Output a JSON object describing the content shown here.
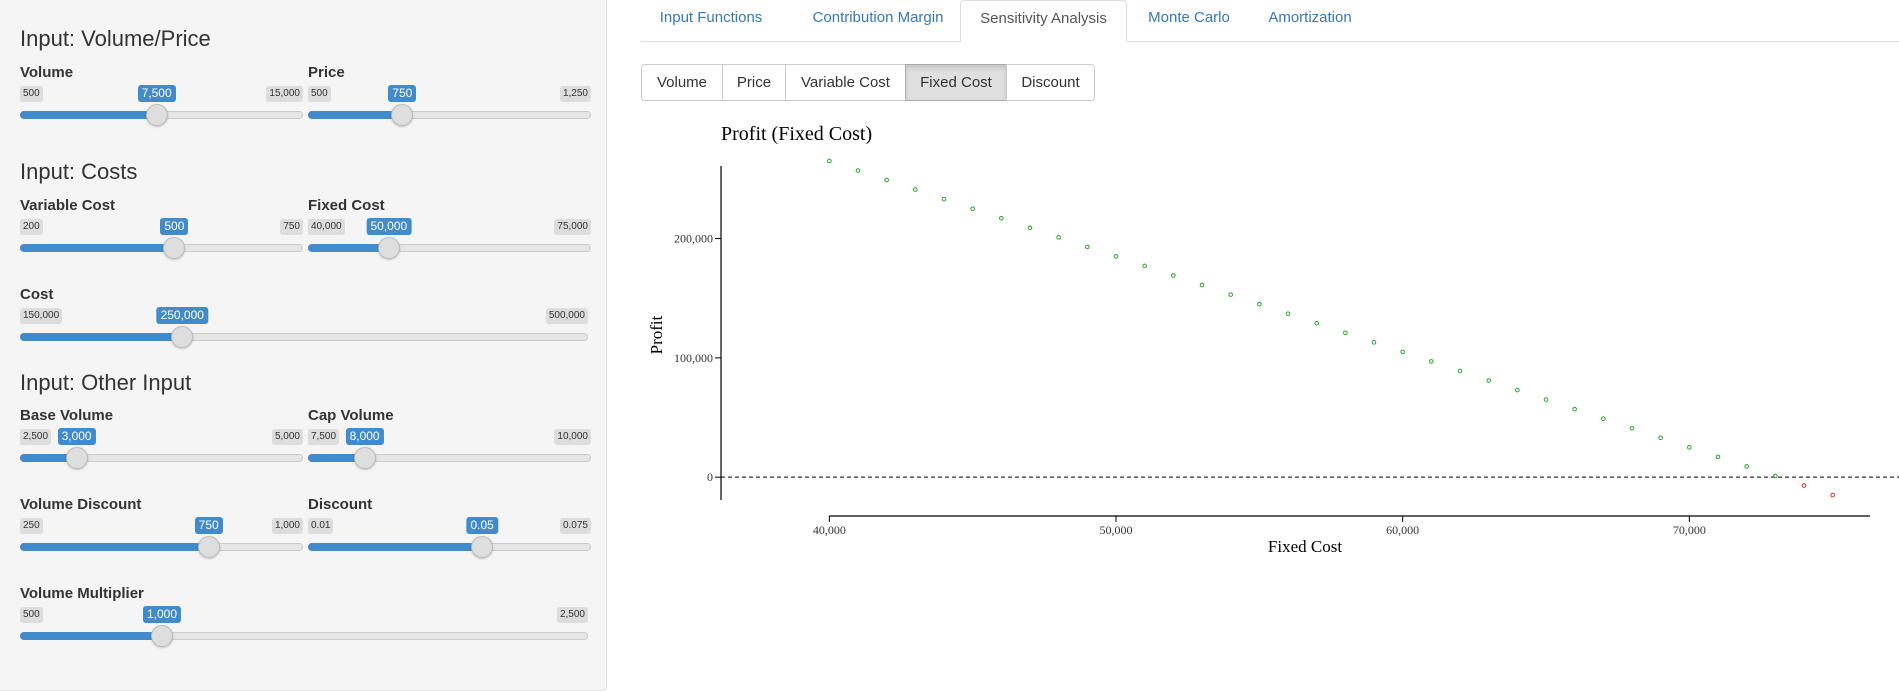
{
  "sidebar": {
    "sections": [
      {
        "title": "Input: Volume/Price"
      },
      {
        "title": "Input: Costs"
      },
      {
        "title": "Input: Other Input"
      }
    ],
    "sliders": [
      {
        "label": "Volume",
        "min": "500",
        "max": "15,000",
        "value": "7,500",
        "fraction": 0.4828
      },
      {
        "label": "Price",
        "min": "500",
        "max": "1,250",
        "value": "750",
        "fraction": 0.3333
      },
      {
        "label": "Variable Cost",
        "min": "200",
        "max": "750",
        "value": "500",
        "fraction": 0.5455
      },
      {
        "label": "Fixed Cost",
        "min": "40,000",
        "max": "75,000",
        "value": "50,000",
        "fraction": 0.2857
      },
      {
        "label": "Cost",
        "min": "150,000",
        "max": "500,000",
        "value": "250,000",
        "fraction": 0.2857
      },
      {
        "label": "Base Volume",
        "min": "2,500",
        "max": "5,000",
        "value": "3,000",
        "fraction": 0.2
      },
      {
        "label": "Cap Volume",
        "min": "7,500",
        "max": "10,000",
        "value": "8,000",
        "fraction": 0.2
      },
      {
        "label": "Volume Discount",
        "min": "250",
        "max": "1,000",
        "value": "750",
        "fraction": 0.6667
      },
      {
        "label": "Discount",
        "min": "0.01",
        "max": "0.075",
        "value": "0.05",
        "fraction": 0.6154
      },
      {
        "label": "Volume Multiplier",
        "min": "500",
        "max": "2,500",
        "value": "1,000",
        "fraction": 0.25
      }
    ]
  },
  "tabs": [
    {
      "label": "Input Functions",
      "active": false
    },
    {
      "label": "Contribution Margin",
      "active": false
    },
    {
      "label": "Sensitivity Analysis",
      "active": true
    },
    {
      "label": "Monte Carlo",
      "active": false
    },
    {
      "label": "Amortization",
      "active": false
    }
  ],
  "buttons": [
    {
      "label": "Volume",
      "active": false
    },
    {
      "label": "Price",
      "active": false
    },
    {
      "label": "Variable Cost",
      "active": false
    },
    {
      "label": "Fixed Cost",
      "active": true
    },
    {
      "label": "Discount",
      "active": false
    }
  ],
  "colors": {
    "accent": "#428bca",
    "positive": "#2ca02c",
    "negative": "#d62728"
  },
  "chart_data": {
    "type": "scatter",
    "title": "Profit (Fixed Cost)",
    "xlabel": "Fixed Cost",
    "ylabel": "Profit",
    "xlim": [
      38000,
      77000
    ],
    "ylim": [
      -25000,
      270000
    ],
    "xticks": [
      {
        "value": 40000,
        "label": "40,000"
      },
      {
        "value": 50000,
        "label": "50,000"
      },
      {
        "value": 60000,
        "label": "60,000"
      },
      {
        "value": 70000,
        "label": "70,000"
      }
    ],
    "yticks": [
      {
        "value": 0,
        "label": "0"
      },
      {
        "value": 100000,
        "label": "100,000"
      },
      {
        "value": 200000,
        "label": "200,000"
      }
    ],
    "reference_line_y": 0,
    "x": [
      40000,
      41000,
      42000,
      43000,
      44000,
      45000,
      46000,
      47000,
      48000,
      49000,
      50000,
      51000,
      52000,
      53000,
      54000,
      55000,
      56000,
      57000,
      58000,
      59000,
      60000,
      61000,
      62000,
      63000,
      64000,
      65000,
      66000,
      67000,
      68000,
      69000,
      70000,
      71000,
      72000,
      73000,
      74000,
      75000
    ],
    "y": [
      265000,
      257000,
      249000,
      241000,
      233000,
      225000,
      217000,
      209000,
      201000,
      193000,
      185000,
      177000,
      169000,
      161000,
      153000,
      145000,
      137000,
      129000,
      121000,
      113000,
      105000,
      97000,
      89000,
      81000,
      73000,
      65000,
      57000,
      49000,
      41000,
      33000,
      25000,
      17000,
      9000,
      1000,
      -7000,
      -15000
    ]
  }
}
